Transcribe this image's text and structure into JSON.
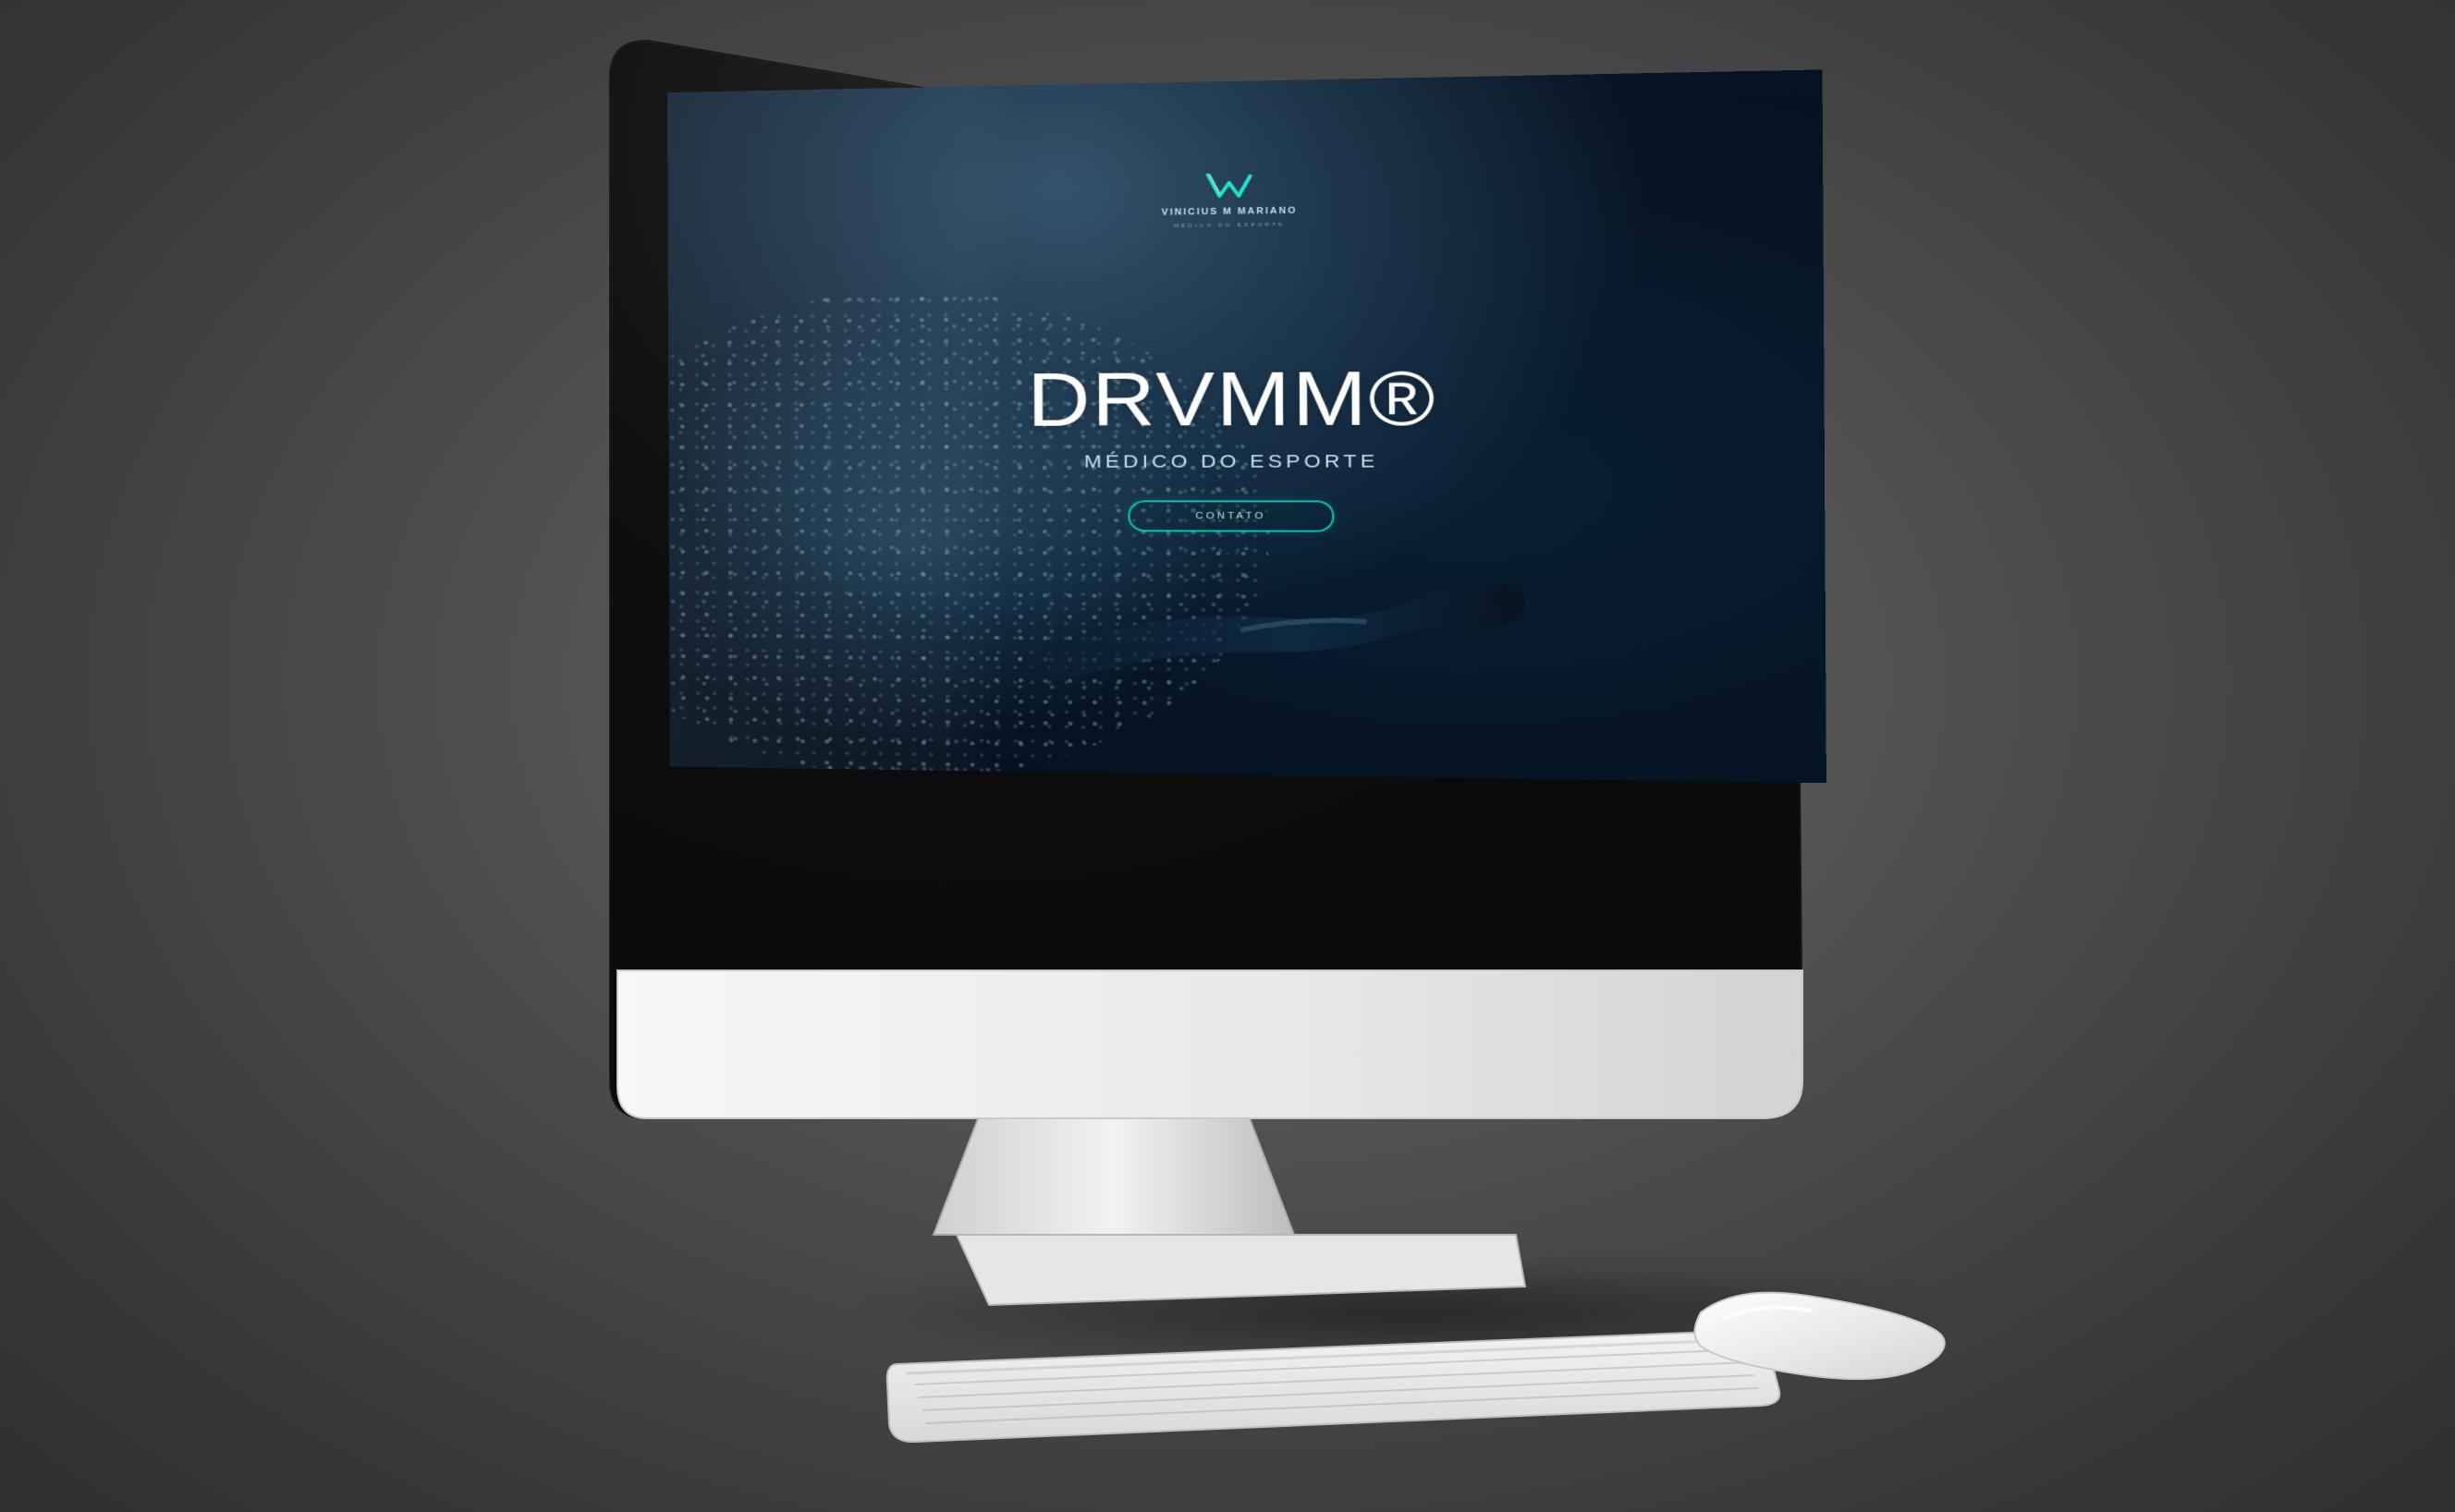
{
  "site": {
    "logo": {
      "name": "VINICIUS M MARIANO",
      "tagline": "MÉDICO DO ESPORTE"
    },
    "hero": {
      "title": "DRVMM®",
      "subtitle": "MÉDICO DO ESPORTE",
      "cta_label": "CONTATO"
    }
  },
  "colors": {
    "background": "#4d4d4d",
    "site_background": "#0f2b45",
    "accent": "#00e6cd",
    "text": "#ffffff"
  }
}
